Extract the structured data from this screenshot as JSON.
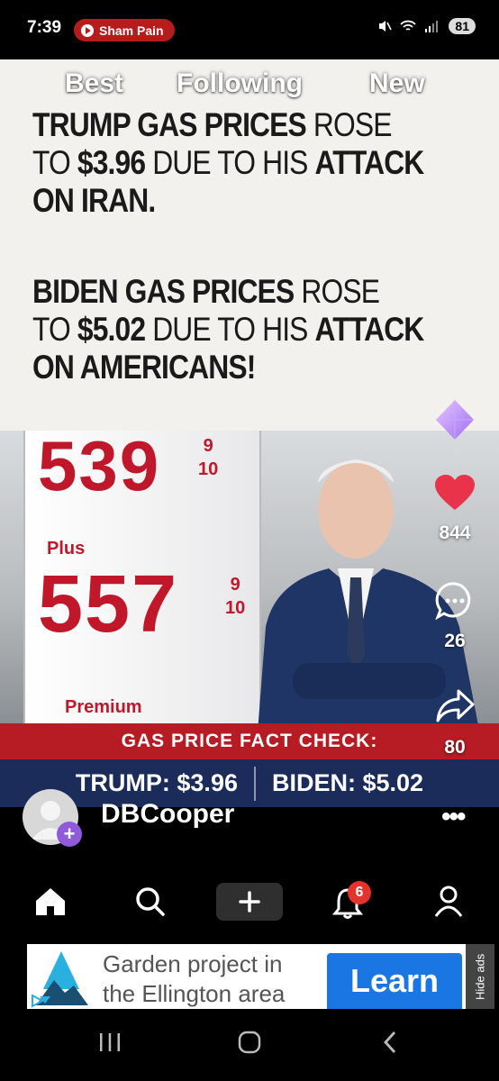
{
  "status_bar": {
    "time": "7:39",
    "now_playing": "Sham Pain",
    "battery": "81"
  },
  "feed_tabs": [
    "Best",
    "Following",
    "New"
  ],
  "post_image": {
    "headline_1": {
      "bold_a": "TRUMP GAS PRICES",
      "light_a": "ROSE",
      "light_b": "TO",
      "bold_b": "$3.96",
      "light_c": "DUE TO HIS",
      "bold_c": "ATTACK",
      "bold_d": "ON IRAN."
    },
    "headline_2": {
      "bold_a": "BIDEN GAS PRICES",
      "light_a": "ROSE",
      "light_b": "TO",
      "bold_b": "$5.02",
      "light_c": "DUE TO HIS",
      "bold_c": "ATTACK",
      "bold_d": "ON AMERICANS!"
    },
    "sign": {
      "price_1": "539",
      "price_2": "557",
      "fraction_top": "9",
      "fraction_bottom": "10",
      "label_plus": "Plus",
      "label_premium": "Premium"
    },
    "fact_check_title": "GAS PRICE FACT CHECK:",
    "fact_trump": "TRUMP: $3.96",
    "fact_biden": "BIDEN: $5.02"
  },
  "actions": {
    "likes": "844",
    "comments": "26",
    "shares": "80"
  },
  "author": {
    "name": "DBCooper"
  },
  "bottom_nav": {
    "notifications_badge": "6"
  },
  "ad": {
    "text_line_1": "Garden project in",
    "text_line_2": "the Ellington area",
    "cta": "Learn",
    "hide_label": "Hide ads"
  },
  "colors": {
    "like_heart": "#e8334a",
    "fact_band_red": "#b71c24",
    "fact_band_blue": "#1c2c5a",
    "ad_button": "#1976e3",
    "badge": "#e5322d"
  }
}
